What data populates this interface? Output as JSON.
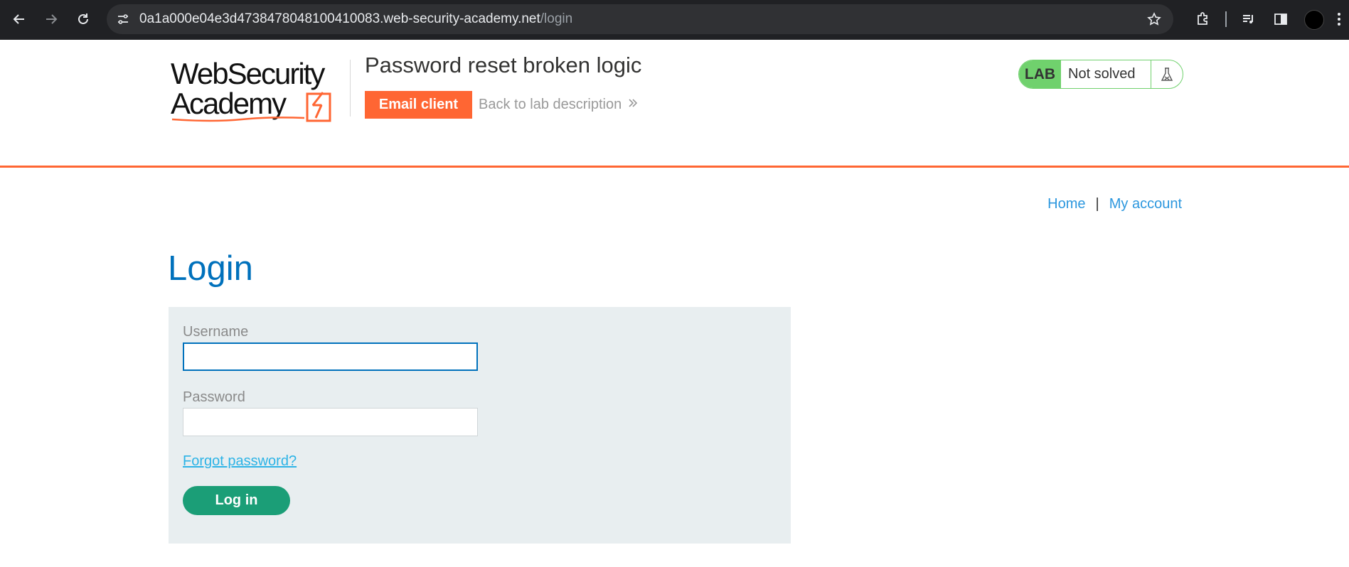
{
  "browser": {
    "url_host": "0a1a000e04e3d4738478048100410083.web-security-academy.net",
    "url_path": "/login"
  },
  "header": {
    "logo_alt": "Web Security Academy",
    "lab_title": "Password reset broken logic",
    "email_client_label": "Email client",
    "back_link_label": "Back to lab description",
    "lab_badge": "LAB",
    "lab_status": "Not solved"
  },
  "nav": {
    "home_label": "Home",
    "separator": "|",
    "account_label": "My account"
  },
  "login": {
    "title": "Login",
    "username_label": "Username",
    "username_value": "",
    "password_label": "Password",
    "password_value": "",
    "forgot_label": "Forgot password?",
    "submit_label": "Log in"
  },
  "colors": {
    "accent_orange": "#ff6633",
    "title_blue": "#0071bc",
    "link_blue": "#2c97de",
    "button_green": "#1b9e77",
    "badge_green": "#70d16d"
  }
}
